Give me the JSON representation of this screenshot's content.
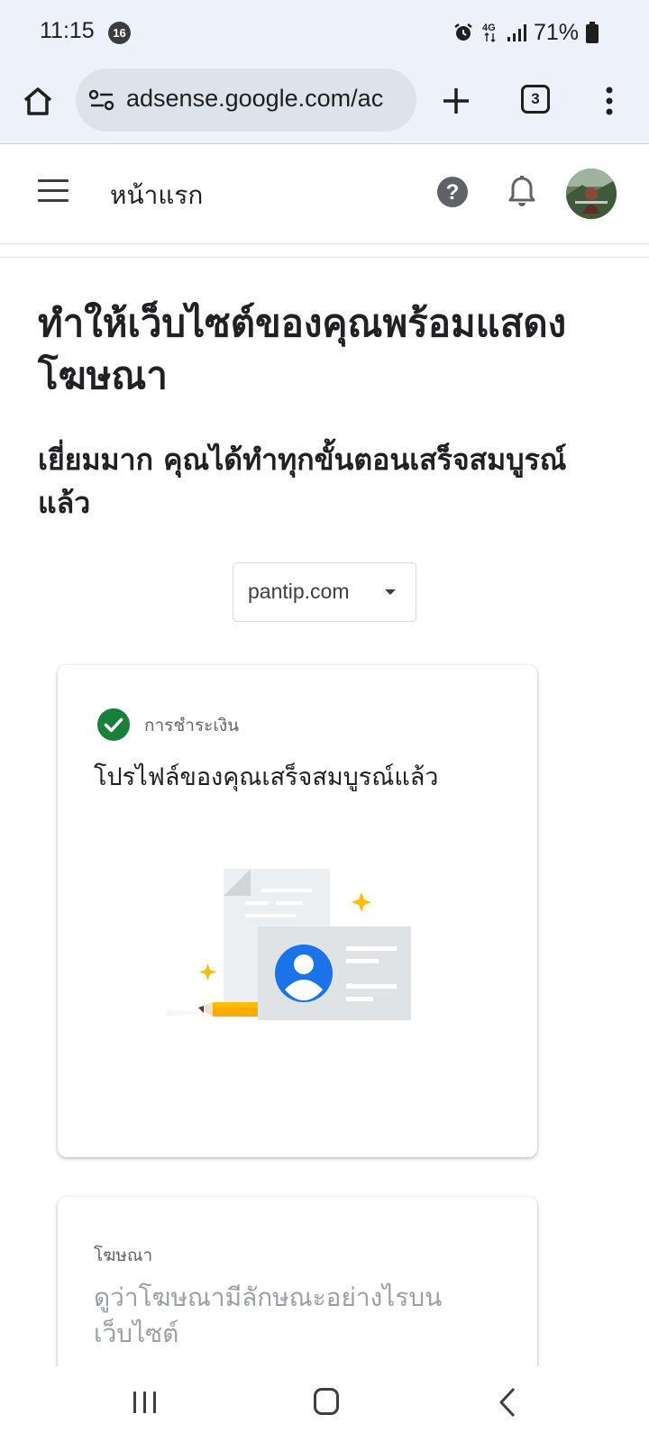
{
  "status_bar": {
    "time": "11:15",
    "notification_count": "16",
    "network": "4G",
    "battery": "71%"
  },
  "browser": {
    "url": "adsense.google.com/ac",
    "tab_count": "3"
  },
  "app_header": {
    "title": "หน้าแรก"
  },
  "main": {
    "title": "ทำให้เว็บไซต์ของคุณพร้อมแสดงโฆษณา",
    "subtitle": "เยี่ยมมาก คุณได้ทำทุกขั้นตอนเสร็จสมบูรณ์แล้ว",
    "site_selector": {
      "value": "pantip.com"
    }
  },
  "cards": [
    {
      "label": "การชำระเงิน",
      "title": "โปรไฟล์ของคุณเสร็จสมบูรณ์แล้ว",
      "status": "complete",
      "status_color": "#188038"
    },
    {
      "label": "โฆษณา",
      "title": "ดูว่าโฆษณามีลักษณะอย่างไรบนเว็บไซต์"
    }
  ],
  "colors": {
    "browser_chrome": "#edf2fa",
    "url_bar": "#dde3ea",
    "accent_blue": "#1a73e8",
    "success_green": "#188038",
    "sparkle_yellow": "#fbbc04"
  },
  "icons": {
    "home": "home-icon",
    "site_settings": "tune-icon",
    "new_tab": "plus-icon",
    "tabs": "tab-switcher-icon",
    "menu": "more-vert-icon",
    "app_menu": "hamburger-icon",
    "help": "help-icon",
    "notifications": "bell-icon",
    "complete": "check-circle-icon"
  }
}
